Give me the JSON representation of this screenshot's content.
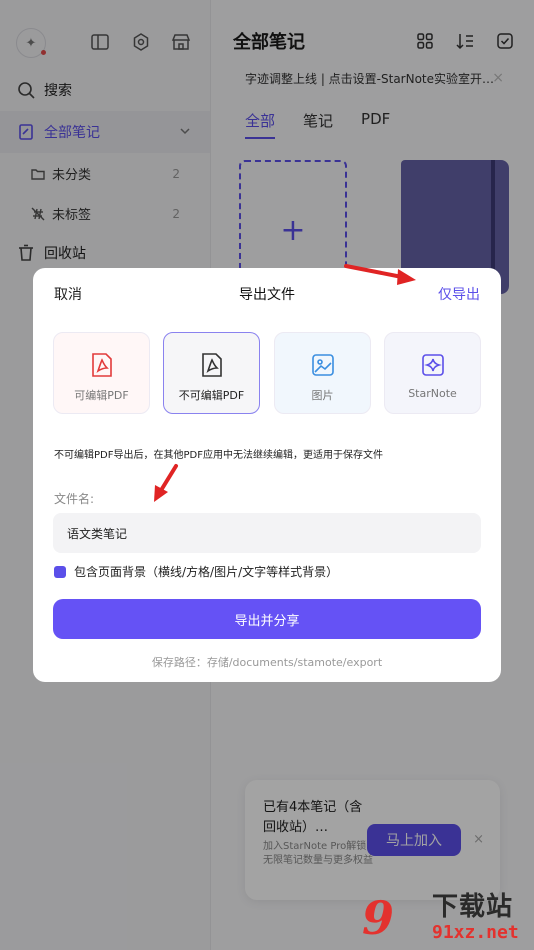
{
  "sidebar": {
    "search_label": "搜索",
    "all_notes_label": "全部笔记",
    "uncategorized": {
      "label": "未分类",
      "count": "2"
    },
    "untagged": {
      "label": "未标签",
      "count": "2"
    },
    "trash_label": "回收站"
  },
  "main": {
    "title": "全部笔记",
    "banner": "字迹调整上线 | 点击设置-StarNote实验室开…",
    "banner_close": "×",
    "tabs": [
      {
        "label": "全部"
      },
      {
        "label": "笔记"
      },
      {
        "label": "PDF"
      }
    ],
    "new_note_plus": "+"
  },
  "promo": {
    "title": "已有4本笔记（含回收站）…",
    "subtitle": "加入StarNote Pro解锁无限笔记数量与更多权益",
    "button": "马上加入",
    "close": "×"
  },
  "dialog": {
    "cancel": "取消",
    "title": "导出文件",
    "export_only": "仅导出",
    "options": [
      {
        "label": "可编辑PDF",
        "icon": "editable-pdf-icon"
      },
      {
        "label": "不可编辑PDF",
        "icon": "locked-pdf-icon",
        "selected": true
      },
      {
        "label": "图片",
        "icon": "image-icon"
      },
      {
        "label": "StarNote",
        "icon": "starnote-icon"
      }
    ],
    "description": "不可编辑PDF导出后，在其他PDF应用中无法继续编辑，更适用于保存文件",
    "filename_label": "文件名:",
    "filename_value": "语文类笔记",
    "include_background_label": "包含页面背景（横线/方格/图片/文字等样式背景）",
    "include_background_checked": true,
    "share_button": "导出并分享",
    "save_path": "保存路径：存储/documents/stamote/export"
  },
  "watermark": {
    "logo": "9",
    "text": "下载站",
    "url": "91xz.net"
  },
  "colors": {
    "accent": "#5b4fe9",
    "button": "#6552f5",
    "annotation_arrow": "#e02424"
  }
}
